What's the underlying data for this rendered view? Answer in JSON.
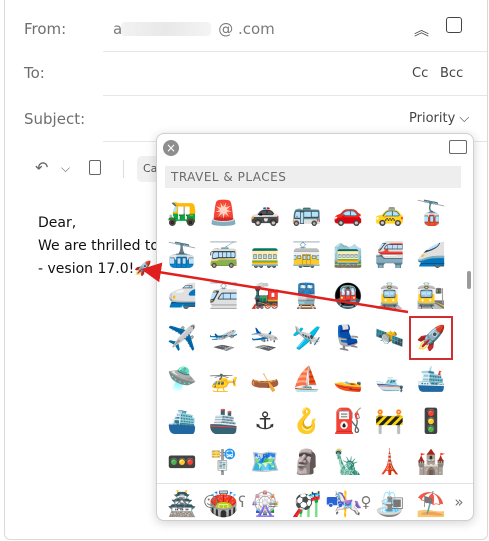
{
  "header": {
    "from_label": "From:",
    "from_value": "a",
    "from_domain": "@ .com",
    "to_label": "To:",
    "cc_label": "Cc",
    "bcc_label": "Bcc",
    "subject_label": "Subject:",
    "priority_label": "Priority"
  },
  "toolbar": {
    "font_label": "Ca"
  },
  "message": {
    "line1": "Dear,",
    "line2": "We are thrilled to in",
    "line3": "- vesion 17.0!🚀"
  },
  "picker": {
    "section_title": "TRAVEL & PLACES",
    "emojis": [
      "🛺",
      "🚨",
      "🚓",
      "🚌",
      "🚗",
      "🚕",
      "🚡",
      "🚠",
      "🚎",
      "🚃",
      "🚋",
      "🚞",
      "🚝",
      "🚄",
      "🚅",
      "🚈",
      "🚂",
      "🚆",
      "🚇",
      "🚊",
      "🚉",
      "✈️",
      "🛫",
      "🛬",
      "🛩️",
      "💺",
      "🛰️",
      "🚀",
      "🛸",
      "🚁",
      "🛶",
      "⛵",
      "🚤",
      "🛥️",
      "🛳️",
      "⛴️",
      "🚢",
      "⚓",
      "🪝",
      "⛽",
      "🚧",
      "🚦",
      "🚥",
      "🚏",
      "🗺️",
      "🗿",
      "🗽",
      "🗼",
      "🏰",
      "🏯",
      "🏟️",
      "🎡",
      "🎢",
      "🎠",
      "⛲",
      "⛱️"
    ],
    "selected": "🚀",
    "footer_icons": [
      "clock-icon",
      "smiley-icon",
      "bear-icon",
      "food-icon",
      "ball-icon",
      "travel-icon",
      "bulb-icon",
      "symbols-icon",
      "flag-icon",
      "more-icon"
    ]
  },
  "colors": {
    "highlight": "#d12f2f",
    "arrow": "#e0201f",
    "active_tab": "#2a64d6"
  }
}
